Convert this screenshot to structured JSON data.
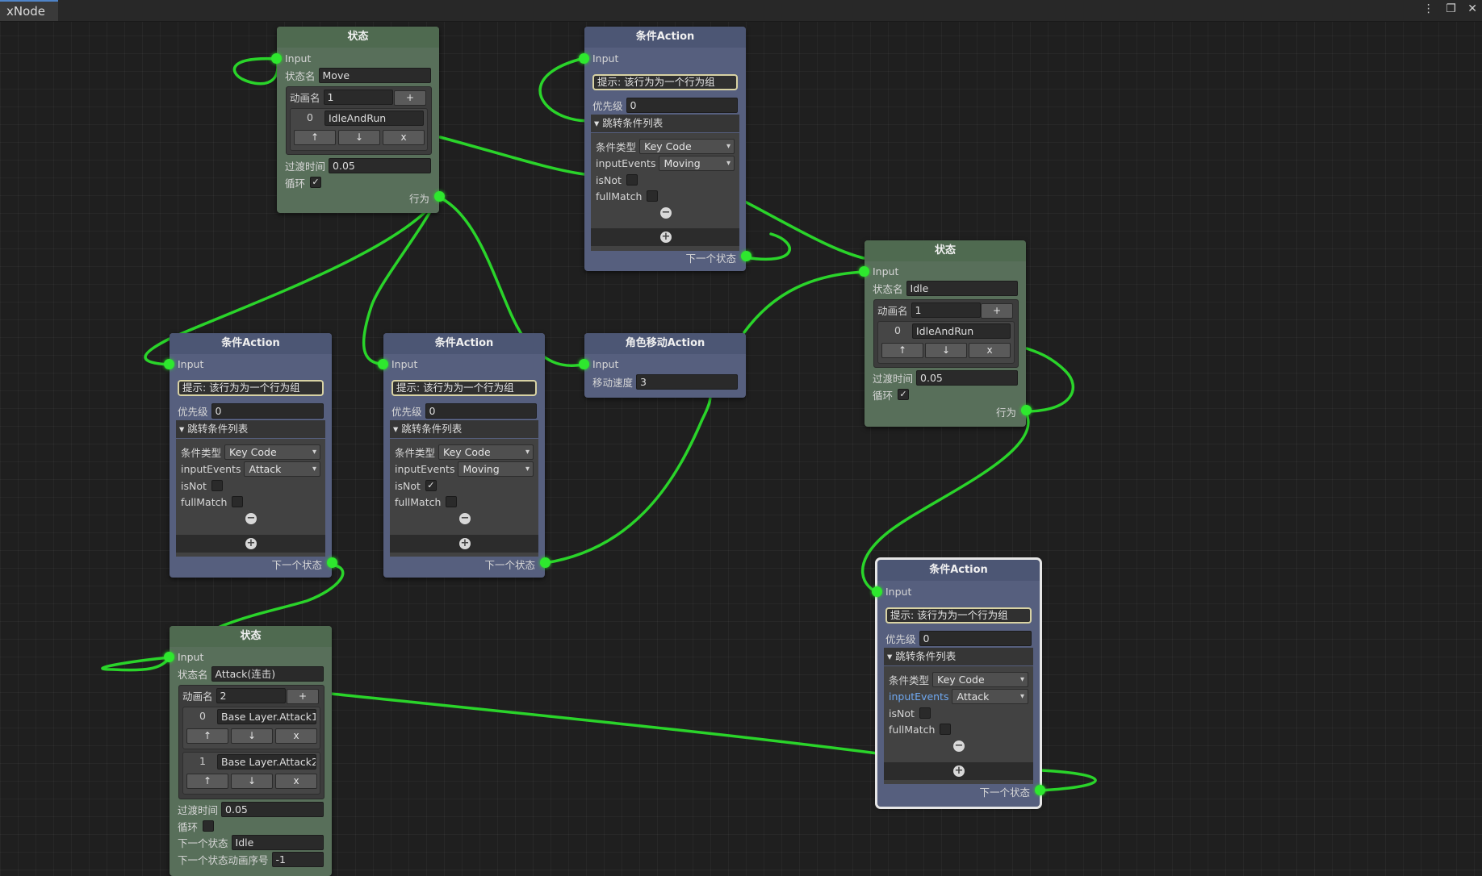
{
  "window": {
    "tab_title": "xNode",
    "menu_icon": "⋮",
    "maximize_icon": "❐",
    "close_icon": "✕"
  },
  "nodes": {
    "state_move": {
      "title": "状态",
      "input_label": "Input",
      "state_name_label": "状态名",
      "state_name": "Move",
      "anim_label": "动画名",
      "anim_count": "1",
      "add_btn": "+",
      "anim_items": [
        {
          "index": "0",
          "name": "IdleAndRun"
        }
      ],
      "up_btn": "↑",
      "down_btn": "↓",
      "del_btn": "x",
      "transition_label": "过渡时间",
      "transition": "0.05",
      "loop_label": "循环",
      "loop_checked": "✓",
      "output_label": "行为"
    },
    "cond_top": {
      "title": "条件Action",
      "input_label": "Input",
      "hint": "提示: 该行为为一个行为组",
      "priority_label": "优先级",
      "priority": "0",
      "list_label": "跳转条件列表",
      "cond_type_label": "条件类型",
      "cond_type": "Key Code",
      "input_events_label": "inputEvents",
      "input_events": "Moving",
      "isnot_label": "isNot",
      "isnot_checked": "",
      "fullmatch_label": "fullMatch",
      "fullmatch_checked": "",
      "remove_btn": "−",
      "add_btn": "+",
      "output_label": "下一个状态"
    },
    "state_idle": {
      "title": "状态",
      "input_label": "Input",
      "state_name_label": "状态名",
      "state_name": "Idle",
      "anim_label": "动画名",
      "anim_count": "1",
      "add_btn": "+",
      "anim_items": [
        {
          "index": "0",
          "name": "IdleAndRun"
        }
      ],
      "up_btn": "↑",
      "down_btn": "↓",
      "del_btn": "x",
      "transition_label": "过渡时间",
      "transition": "0.05",
      "loop_label": "循环",
      "loop_checked": "✓",
      "output_label": "行为"
    },
    "cond_attack": {
      "title": "条件Action",
      "input_label": "Input",
      "hint": "提示: 该行为为一个行为组",
      "priority_label": "优先级",
      "priority": "0",
      "list_label": "跳转条件列表",
      "cond_type_label": "条件类型",
      "cond_type": "Key Code",
      "input_events_label": "inputEvents",
      "input_events": "Attack",
      "isnot_label": "isNot",
      "isnot_checked": "",
      "fullmatch_label": "fullMatch",
      "fullmatch_checked": "",
      "remove_btn": "−",
      "add_btn": "+",
      "output_label": "下一个状态"
    },
    "cond_moving": {
      "title": "条件Action",
      "input_label": "Input",
      "hint": "提示: 该行为为一个行为组",
      "priority_label": "优先级",
      "priority": "0",
      "list_label": "跳转条件列表",
      "cond_type_label": "条件类型",
      "cond_type": "Key Code",
      "input_events_label": "inputEvents",
      "input_events": "Moving",
      "isnot_label": "isNot",
      "isnot_checked": "✓",
      "fullmatch_label": "fullMatch",
      "fullmatch_checked": "",
      "remove_btn": "−",
      "add_btn": "+",
      "output_label": "下一个状态"
    },
    "move_action": {
      "title": "角色移动Action",
      "input_label": "Input",
      "speed_label": "移动速度",
      "speed": "3"
    },
    "cond_selected": {
      "title": "条件Action",
      "input_label": "Input",
      "hint": "提示: 该行为为一个行为组",
      "priority_label": "优先级",
      "priority": "0",
      "list_label": "跳转条件列表",
      "cond_type_label": "条件类型",
      "cond_type": "Key Code",
      "input_events_label": "inputEvents",
      "input_events": "Attack",
      "isnot_label": "isNot",
      "isnot_checked": "",
      "fullmatch_label": "fullMatch",
      "fullmatch_checked": "",
      "remove_btn": "−",
      "add_btn": "+",
      "output_label": "下一个状态"
    },
    "state_attack": {
      "title": "状态",
      "input_label": "Input",
      "state_name_label": "状态名",
      "state_name": "Attack(连击)",
      "anim_label": "动画名",
      "anim_count": "2",
      "add_btn": "+",
      "anim_items": [
        {
          "index": "0",
          "name": "Base Layer.Attack1"
        },
        {
          "index": "1",
          "name": "Base Layer.Attack2"
        }
      ],
      "up_btn": "↑",
      "down_btn": "↓",
      "del_btn": "x",
      "transition_label": "过渡时间",
      "transition": "0.05",
      "loop_label": "循环",
      "loop_checked": "",
      "next_state_label": "下一个状态",
      "next_state": "Idle",
      "next_anim_label": "下一个状态动画序号",
      "next_anim": "-1"
    }
  },
  "colors": {
    "wire": "#2ad42a",
    "port": "#2ee82e",
    "state_node": "#586f5a",
    "action_node": "#565f7e",
    "selected_outline": "#e6e6e6"
  }
}
